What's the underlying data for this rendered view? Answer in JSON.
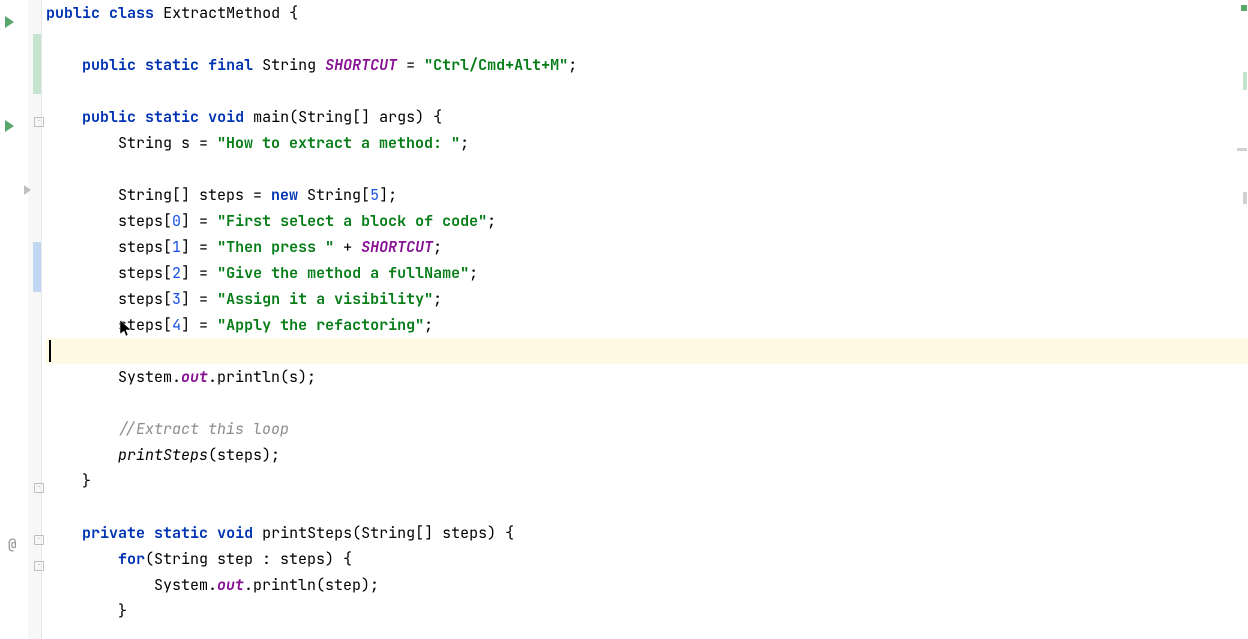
{
  "code": {
    "l1_kw1": "public",
    "l1_kw2": "class",
    "l1_cls": "ExtractMethod",
    "l1_brace": " {",
    "l3_kw1": "public",
    "l3_kw2": "static",
    "l3_kw3": "final",
    "l3_typ": "String",
    "l3_fld": "SHORTCUT",
    "l3_eq": " = ",
    "l3_str": "\"Ctrl/Cmd+Alt+M\"",
    "l3_semi": ";",
    "l5_kw1": "public",
    "l5_kw2": "static",
    "l5_kw3": "void",
    "l5_mtd": "main",
    "l5_params": "(String[] args) {",
    "l6_typ": "String",
    "l6_var": " s = ",
    "l6_str": "\"How to extract a method: \"",
    "l6_semi": ";",
    "l8_pre": "String[] steps = ",
    "l8_kw": "new",
    "l8_post": " String[",
    "l8_num": "5",
    "l8_end": "];",
    "l9_pre": "steps[",
    "l9_num": "0",
    "l9_mid": "] = ",
    "l9_str": "\"First select a block of code\"",
    "l9_semi": ";",
    "l10_pre": "steps[",
    "l10_num": "1",
    "l10_mid": "] = ",
    "l10_str": "\"Then press \"",
    "l10_plus": " + ",
    "l10_fld": "SHORTCUT",
    "l10_semi": ";",
    "l11_pre": "steps[",
    "l11_num": "2",
    "l11_mid": "] = ",
    "l11_str": "\"Give the method a fullName\"",
    "l11_semi": ";",
    "l12_pre": "steps[",
    "l12_num": "3",
    "l12_mid": "] = ",
    "l12_str": "\"Assign it a visibility\"",
    "l12_semi": ";",
    "l13_pre": "steps[",
    "l13_num": "4",
    "l13_mid": "] = ",
    "l13_str": "\"Apply the refactoring\"",
    "l13_semi": ";",
    "l15_sys": "System.",
    "l15_out": "out",
    "l15_call": ".println(s);",
    "l17_cmt": "//Extract this loop",
    "l18_fn": "printSteps",
    "l18_args": "(steps);",
    "l19_brace": "}",
    "l21_kw1": "private",
    "l21_kw2": "static",
    "l21_kw3": "void",
    "l21_mtd": "printSteps",
    "l21_params": "(String[] steps) {",
    "l22_kw": "for",
    "l22_rest": "(String step : steps) {",
    "l23_sys": "System.",
    "l23_out": "out",
    "l23_call": ".println(step);",
    "l24_brace": "}"
  },
  "indent": {
    "i0": "",
    "i1": "    ",
    "i2": "        ",
    "i3": "            "
  },
  "colors": {
    "keyword": "#0033b3",
    "string": "#067d17",
    "number": "#1750eb",
    "field": "#871094",
    "comment": "#8c8c8c",
    "highlight": "#fffae3",
    "run_icon": "#59a869",
    "change_green": "#c5e4ce",
    "change_blue": "#c1d6f0"
  }
}
